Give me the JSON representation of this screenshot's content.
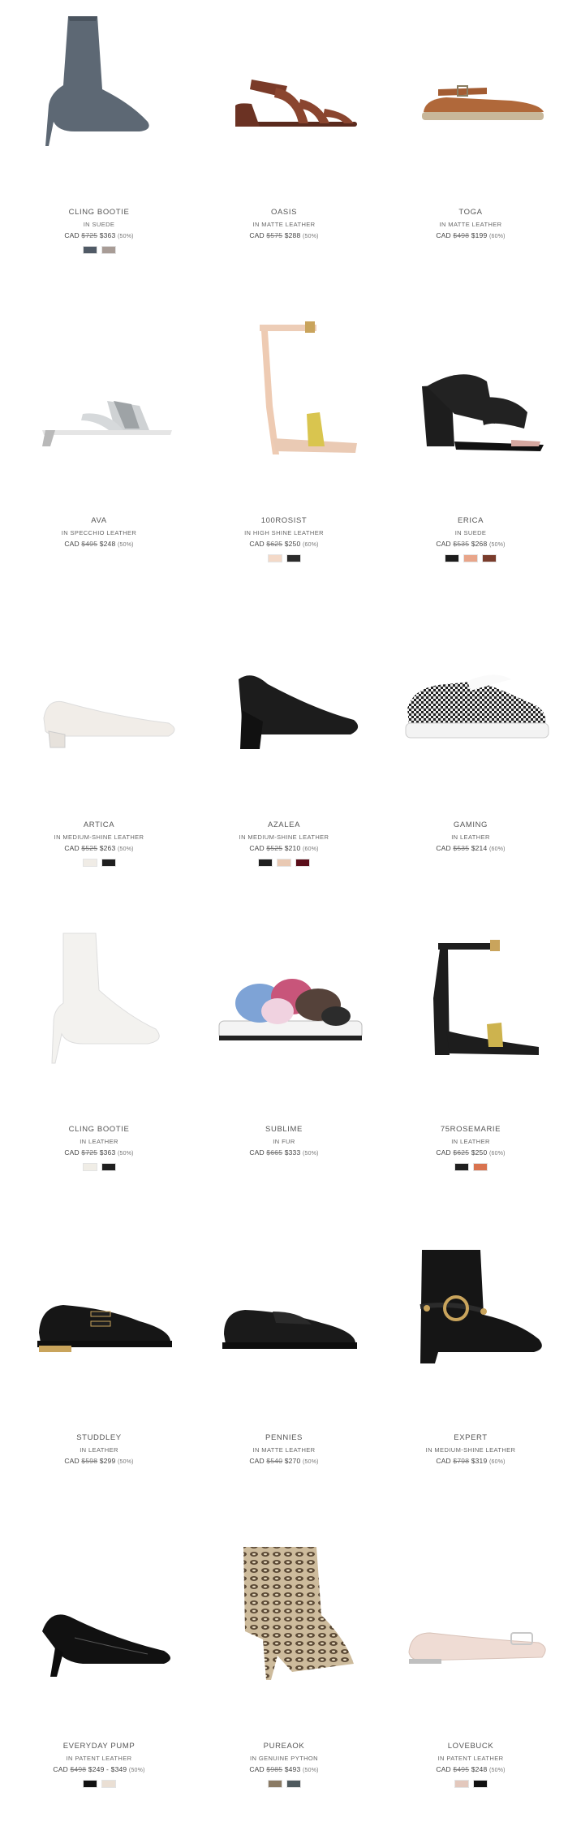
{
  "products": [
    {
      "name": "CLING BOOTIE",
      "material": "IN SUEDE",
      "currency": "CAD",
      "old_price": "$725",
      "price": "$363",
      "discount": "(50%)",
      "swatches": [
        "#505a66",
        "#a89c96"
      ],
      "icon": "gray-suede-bootie-image"
    },
    {
      "name": "OASIS",
      "material": "IN MATTE LEATHER",
      "currency": "CAD",
      "old_price": "$575",
      "price": "$288",
      "discount": "(50%)",
      "swatches": [],
      "icon": "brown-strappy-sandal-image"
    },
    {
      "name": "TOGA",
      "material": "IN MATTE LEATHER",
      "currency": "CAD",
      "old_price": "$498",
      "price": "$199",
      "discount": "(60%)",
      "swatches": [],
      "icon": "tan-espadrille-flat-image"
    },
    {
      "name": "AVA",
      "material": "IN SPECCHIO LEATHER",
      "currency": "CAD",
      "old_price": "$495",
      "price": "$248",
      "discount": "(50%)",
      "swatches": [],
      "icon": "silver-mule-sandal-image"
    },
    {
      "name": "100ROSIST",
      "material": "IN HIGH SHINE LEATHER",
      "currency": "CAD",
      "old_price": "$625",
      "price": "$250",
      "discount": "(60%)",
      "swatches": [
        "#f3d9c8",
        "#2b2b2b"
      ],
      "icon": "nude-ankle-strap-heel-image"
    },
    {
      "name": "ERICA",
      "material": "IN SUEDE",
      "currency": "CAD",
      "old_price": "$535",
      "price": "$268",
      "discount": "(50%)",
      "swatches": [
        "#1c1c1c",
        "#e8a58a",
        "#7a3c2c"
      ],
      "icon": "black-block-heel-sandal-image"
    },
    {
      "name": "ARTICA",
      "material": "IN MEDIUM-SHINE LEATHER",
      "currency": "CAD",
      "old_price": "$525",
      "price": "$263",
      "discount": "(50%)",
      "swatches": [
        "#f0ece6",
        "#1f1f1f"
      ],
      "icon": "white-low-pump-image"
    },
    {
      "name": "AZALEA",
      "material": "IN MEDIUM-SHINE LEATHER",
      "currency": "CAD",
      "old_price": "$525",
      "price": "$210",
      "discount": "(60%)",
      "swatches": [
        "#1f1f1f",
        "#e9c9b3",
        "#5a0e1a"
      ],
      "icon": "black-block-pump-image"
    },
    {
      "name": "GAMING",
      "material": "IN LEATHER",
      "currency": "CAD",
      "old_price": "$535",
      "price": "$214",
      "discount": "(60%)",
      "swatches": [],
      "icon": "checkered-sneaker-image"
    },
    {
      "name": "CLING BOOTIE",
      "material": "IN LEATHER",
      "currency": "CAD",
      "old_price": "$725",
      "price": "$363",
      "discount": "(50%)",
      "swatches": [
        "#f0ede6",
        "#1f1f1f"
      ],
      "icon": "white-leather-bootie-image"
    },
    {
      "name": "SUBLIME",
      "material": "IN FUR",
      "currency": "CAD",
      "old_price": "$665",
      "price": "$333",
      "discount": "(50%)",
      "swatches": [],
      "icon": "fur-slide-image"
    },
    {
      "name": "75ROSEMARIE",
      "material": "IN LEATHER",
      "currency": "CAD",
      "old_price": "$625",
      "price": "$250",
      "discount": "(60%)",
      "swatches": [
        "#1f1f1f",
        "#d9734f"
      ],
      "icon": "black-ankle-strap-sandal-image"
    },
    {
      "name": "STUDDLEY",
      "material": "IN LEATHER",
      "currency": "CAD",
      "old_price": "$598",
      "price": "$299",
      "discount": "(50%)",
      "swatches": [],
      "icon": "black-monk-strap-shoe-image"
    },
    {
      "name": "PENNIES",
      "material": "IN MATTE LEATHER",
      "currency": "CAD",
      "old_price": "$540",
      "price": "$270",
      "discount": "(50%)",
      "swatches": [],
      "icon": "black-loafer-image"
    },
    {
      "name": "EXPERT",
      "material": "IN MEDIUM-SHINE LEATHER",
      "currency": "CAD",
      "old_price": "$798",
      "price": "$319",
      "discount": "(60%)",
      "swatches": [],
      "icon": "black-harness-boot-image"
    },
    {
      "name": "EVERYDAY PUMP",
      "material": "IN PATENT LEATHER",
      "currency": "CAD",
      "old_price": "$498",
      "price": "$249 - $349",
      "discount": "(50%)",
      "swatches": [
        "#111111",
        "#eadfd4"
      ],
      "icon": "black-patent-pump-image"
    },
    {
      "name": "PUREAOK",
      "material": "IN GENUINE PYTHON",
      "currency": "CAD",
      "old_price": "$985",
      "price": "$493",
      "discount": "(50%)",
      "swatches": [
        "#8a7a64",
        "#4f5a5e"
      ],
      "icon": "python-bootie-image"
    },
    {
      "name": "LOVEBUCK",
      "material": "IN PATENT LEATHER",
      "currency": "CAD",
      "old_price": "$495",
      "price": "$248",
      "discount": "(50%)",
      "swatches": [
        "#e3c8bd",
        "#111111"
      ],
      "icon": "blush-patent-flat-image"
    }
  ]
}
